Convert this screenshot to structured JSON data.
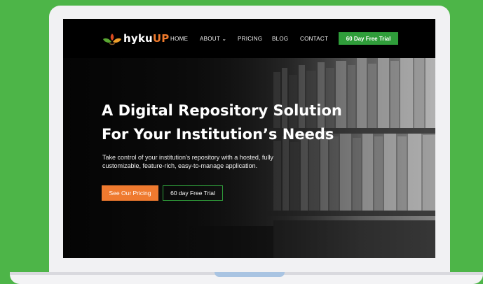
{
  "brand": {
    "name_main": "hyku",
    "name_accent": "UP",
    "accent_color": "#f07a2c",
    "green_color": "#2f9d3a"
  },
  "nav": {
    "items": [
      {
        "label": "HOME"
      },
      {
        "label": "ABOUT ⌄"
      },
      {
        "label": "PRICING"
      },
      {
        "label": "BLOG"
      },
      {
        "label": "CONTACT"
      }
    ],
    "cta_label": "60 Day Free Trial"
  },
  "hero": {
    "title_line1": "A Digital Repository Solution",
    "title_line2": "For Your Institution’s Needs",
    "subtitle": "Take control of your institution's repository with a hosted, fully customizable, feature-rich, easy-to-manage application.",
    "primary_button": "See Our Pricing",
    "secondary_button": "60 day Free Trial"
  }
}
